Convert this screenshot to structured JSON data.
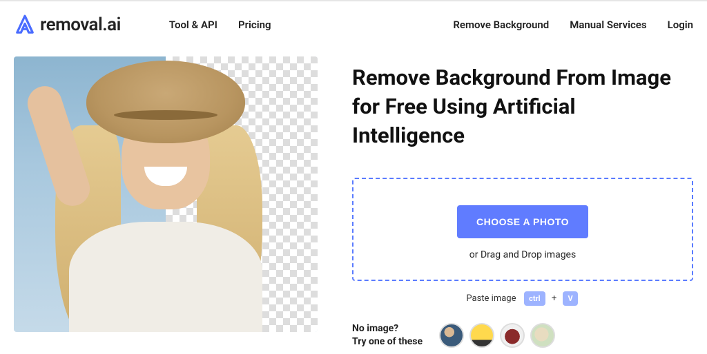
{
  "brand": {
    "name": "removal.ai"
  },
  "nav": {
    "left": [
      "Tool & API",
      "Pricing"
    ],
    "right": [
      "Remove Background",
      "Manual Services",
      "Login"
    ]
  },
  "hero": {
    "headline": "Remove Background From Image for Free Using Artificial Intelligence"
  },
  "upload": {
    "choose_label": "CHOOSE A PHOTO",
    "drag_label": "or Drag and Drop images",
    "paste_label": "Paste image",
    "kbd_ctrl": "ctrl",
    "kbd_plus": "+",
    "kbd_v": "V"
  },
  "samples": {
    "no_image": "No image?",
    "try_one": "Try one of these",
    "thumbs": [
      "sample-person",
      "sample-car",
      "sample-bag",
      "sample-dog"
    ]
  }
}
